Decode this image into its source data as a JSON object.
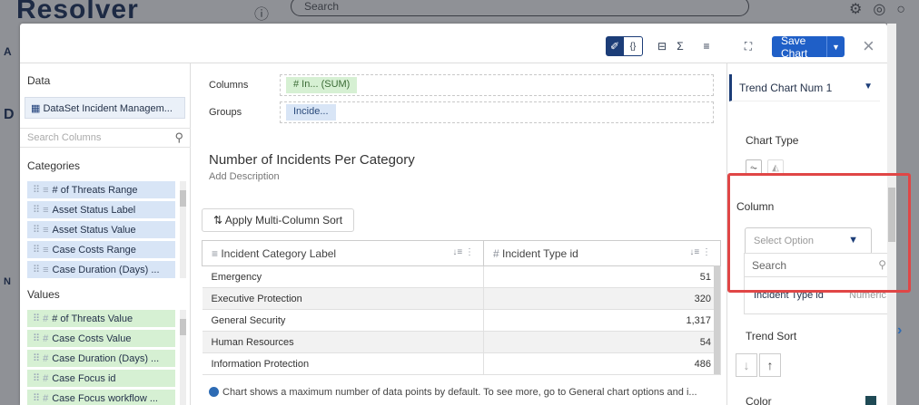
{
  "background": {
    "logo_text": "Resolver",
    "search_placeholder": "Search",
    "side_letters": [
      "A",
      "D",
      "N"
    ]
  },
  "toolbar": {
    "save_label": "Save Chart",
    "close_label": "×",
    "icons": [
      "pen-icon",
      "braces-icon",
      "filter-icon",
      "sigma-icon",
      "list-icon",
      "expand-icon"
    ]
  },
  "data_panel": {
    "title": "Data",
    "dataset_label": "DataSet Incident Managem...",
    "search_placeholder": "Search Columns",
    "categories_label": "Categories",
    "categories": [
      "# of Threats Range",
      "Asset Status Label",
      "Asset Status Value",
      "Case Costs Range",
      "Case Duration (Days) ..."
    ],
    "values_label": "Values",
    "values": [
      "# of Threats Value",
      "Case Costs Value",
      "Case Duration (Days) ...",
      "Case Focus id",
      "Case Focus workflow ..."
    ]
  },
  "center": {
    "columns_label": "Columns",
    "columns_pill": "# In... (SUM)",
    "groups_label": "Groups",
    "groups_pill": "Incide...",
    "chart_title": "Number of Incidents Per Category",
    "add_description": "Add Description",
    "apply_sort": "Apply Multi-Column Sort",
    "table": {
      "headers": [
        "Incident Category Label",
        "Incident Type id"
      ],
      "rows": [
        [
          "Emergency",
          "51"
        ],
        [
          "Executive Protection",
          "320"
        ],
        [
          "General Security",
          "1,317"
        ],
        [
          "Human Resources",
          "54"
        ],
        [
          "Information Protection",
          "486"
        ]
      ]
    },
    "info_text": "Chart shows a maximum number of data points by default. To see more, go to General chart options and i..."
  },
  "right_panel": {
    "chart_selector": "Trend Chart Num 1",
    "chart_type_label": "Chart Type",
    "column_label": "Column",
    "select_placeholder": "Select Option",
    "dropdown_search": "Search",
    "option_label": "Incident Type id",
    "option_type": "Numeric",
    "trend_sort_label": "Trend Sort",
    "color_label": "Color",
    "color_swatch": "#1f4a55"
  }
}
